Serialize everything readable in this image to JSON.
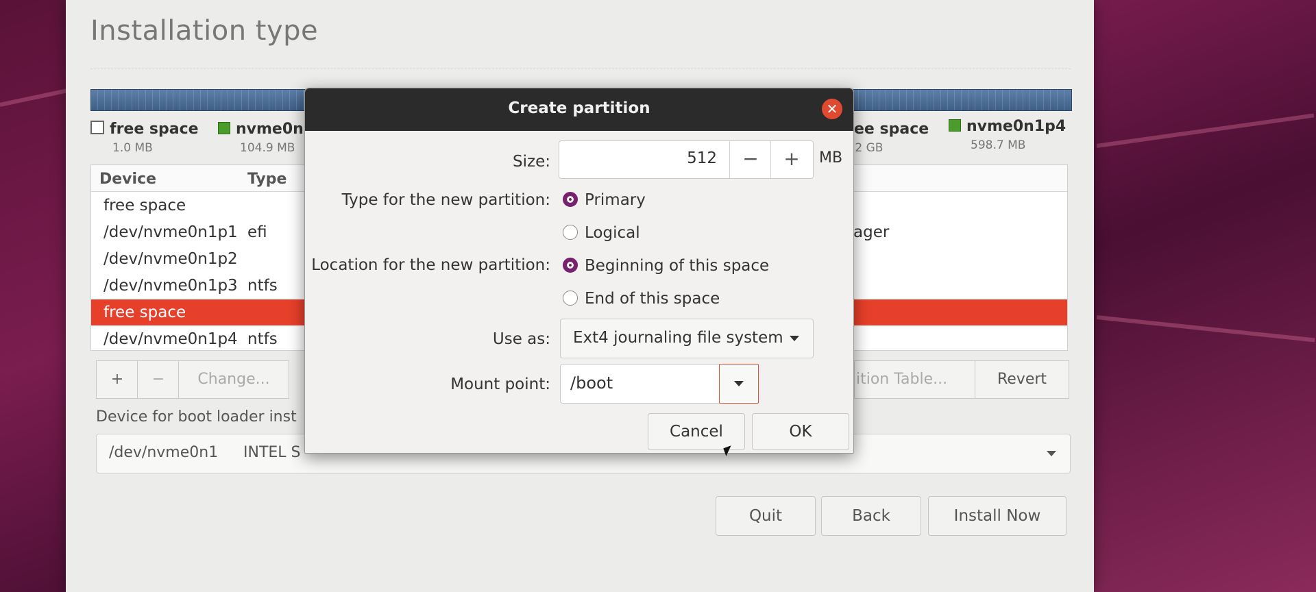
{
  "installer": {
    "title": "Installation type",
    "legend": [
      {
        "label": "free space",
        "size": "1.0 MB",
        "swatch": "empty"
      },
      {
        "label": "nvme0n",
        "size": "104.9 MB",
        "swatch": "green"
      },
      {
        "label": "ee space",
        "size": ".2 GB",
        "swatch": "none"
      },
      {
        "label": "nvme0n1p4",
        "size": "598.7 MB",
        "swatch": "green"
      }
    ],
    "table": {
      "headers": [
        "Device",
        "Type"
      ],
      "rows": [
        {
          "device": "free space",
          "type": "",
          "extra": ""
        },
        {
          "device": "/dev/nvme0n1p1",
          "type": "efi",
          "extra": "ager"
        },
        {
          "device": "/dev/nvme0n1p2",
          "type": "",
          "extra": ""
        },
        {
          "device": "/dev/nvme0n1p3",
          "type": "ntfs",
          "extra": ""
        },
        {
          "device": "free space",
          "type": "",
          "extra": "",
          "selected": true
        },
        {
          "device": "/dev/nvme0n1p4",
          "type": "ntfs",
          "extra": ""
        }
      ]
    },
    "toolbar": {
      "add": "+",
      "remove": "−",
      "change": "Change...",
      "new_table": "ition Table...",
      "revert": "Revert"
    },
    "boot_loader_label": "Device for boot loader inst",
    "boot_device": "/dev/nvme0n1",
    "boot_device_desc": "INTEL S",
    "buttons": {
      "quit": "Quit",
      "back": "Back",
      "install": "Install Now"
    }
  },
  "dialog": {
    "title": "Create partition",
    "size_label": "Size:",
    "size_value": "512",
    "size_minus": "−",
    "size_plus": "+",
    "size_unit": "MB",
    "type_label": "Type for the new partition:",
    "type_primary": "Primary",
    "type_logical": "Logical",
    "location_label": "Location for the new partition:",
    "location_beginning": "Beginning of this space",
    "location_end": "End of this space",
    "use_as_label": "Use as:",
    "use_as_value": "Ext4 journaling file system",
    "mount_label": "Mount point:",
    "mount_value": "/boot",
    "cancel": "Cancel",
    "ok": "OK"
  },
  "colors": {
    "accent_selected": "#e7402a",
    "radio": "#77216f",
    "titlebar": "#2b2b2b"
  }
}
